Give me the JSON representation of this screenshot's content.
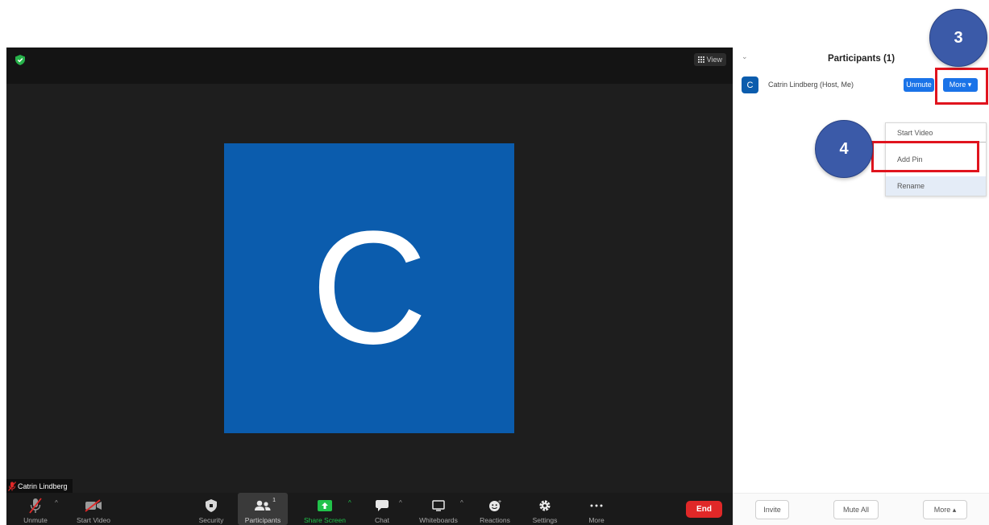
{
  "meeting": {
    "view_label": "View",
    "tile_initial": "C",
    "name_tag": "Catrin Lindberg",
    "toolbar": {
      "unmute": "Unmute",
      "start_video": "Start Video",
      "security": "Security",
      "participants": "Participants",
      "participants_count": "1",
      "share_screen": "Share Screen",
      "chat": "Chat",
      "whiteboards": "Whiteboards",
      "reactions": "Reactions",
      "settings": "Settings",
      "more": "More",
      "end": "End"
    }
  },
  "panel": {
    "collapse_icon": "chevron-down-icon",
    "title": "Participants (1)",
    "participant": {
      "initial": "C",
      "name": "Catrin Lindberg (Host, Me)",
      "unmute_label": "Unmute",
      "more_label": "More ▾"
    },
    "menu": [
      "Start Video",
      "Add Pin",
      "Rename"
    ],
    "footer": {
      "invite": "Invite",
      "mute_all": "Mute All",
      "more": "More ▴"
    }
  },
  "annotations": {
    "step3": "3",
    "step4": "4"
  },
  "colors": {
    "tile_blue": "#0b5cad",
    "action_blue": "#1a73e8",
    "end_red": "#e02828",
    "share_green": "#21c24a",
    "annotation_red": "#e0141e",
    "annotation_circle": "#3b5aa8"
  }
}
